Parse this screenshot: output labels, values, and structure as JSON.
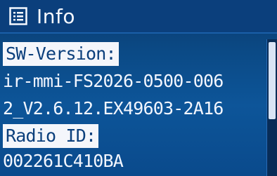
{
  "header": {
    "icon": "list-icon",
    "title": "Info"
  },
  "info": {
    "sw_version_label": "SW-Version:",
    "sw_version_line1": "ir-mmi-FS2026-0500-006",
    "sw_version_line2": "2_V2.6.12.EX49603-2A16",
    "radio_id_label": "Radio ID:",
    "radio_id_value": "002261C410BA"
  },
  "colors": {
    "background": "#0b4a86",
    "highlight": "#f4f6fb",
    "text": "#f2f6ff"
  }
}
